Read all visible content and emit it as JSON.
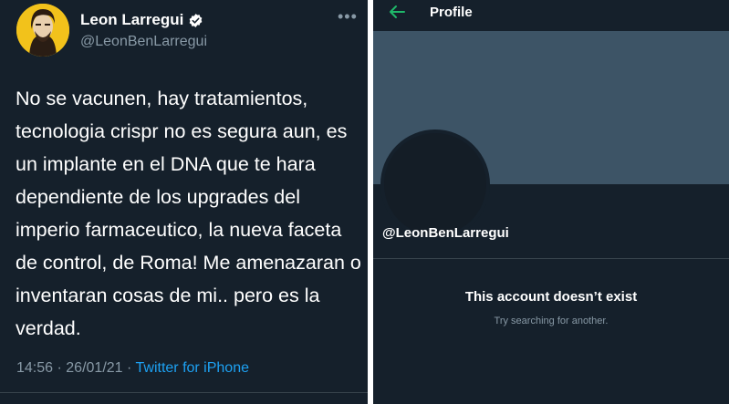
{
  "tweet": {
    "display_name": "Leon Larregui",
    "handle": "@LeonBenLarregui",
    "more_icon": "more-horizontal-icon",
    "verified_icon": "verified-badge-icon",
    "text": "No se vacunen, hay tratamientos, tecnologia crispr no es segura aun, es un implante en el DNA que te hara dependiente de los upgrades del imperio farmaceutico, la nueva faceta de control, de Roma! Me amenazaran o inventaran cosas de mi.. pero es la verdad.",
    "time": "14:56",
    "date": "26/01/21",
    "separator": "·",
    "source": "Twitter for iPhone"
  },
  "profile": {
    "back_icon": "back-arrow-icon",
    "title": "Profile",
    "handle": "@LeonBenLarregui",
    "empty_title": "This account doesn’t exist",
    "empty_subtitle": "Try searching for another."
  },
  "colors": {
    "background": "#15202b",
    "banner": "#3d5466",
    "accent": "#1da1f2",
    "secondary_text": "#8899a6",
    "back_arrow": "#1fb86a"
  }
}
